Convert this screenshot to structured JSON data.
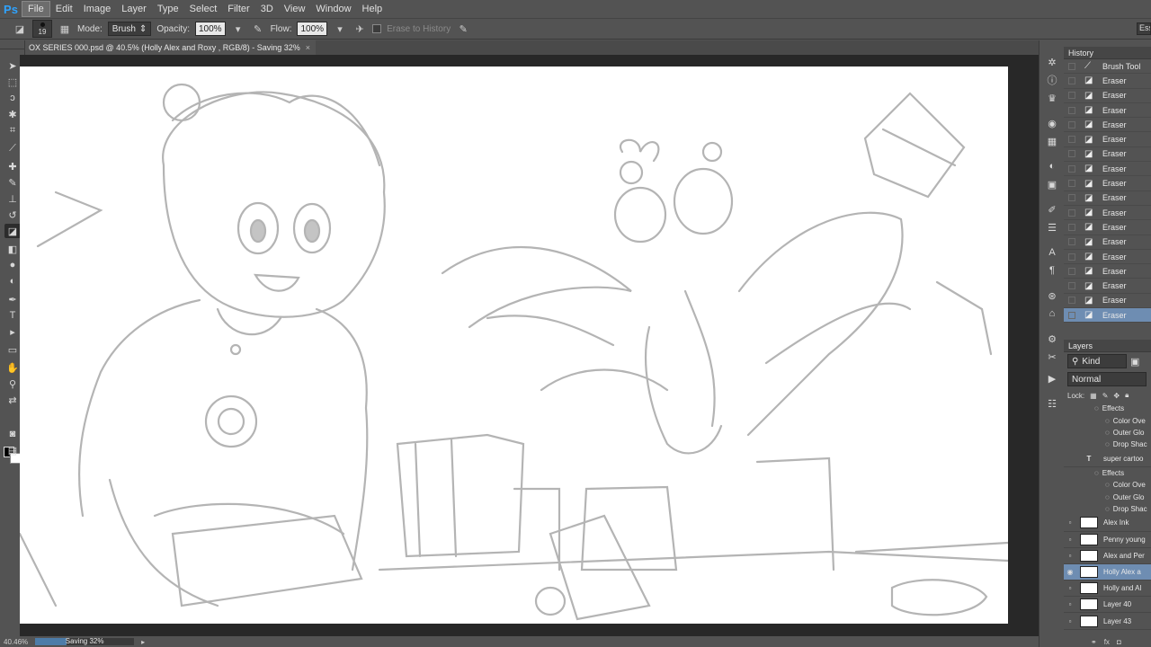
{
  "app": {
    "logo": "Ps"
  },
  "menu": [
    "File",
    "Edit",
    "Image",
    "Layer",
    "Type",
    "Select",
    "Filter",
    "3D",
    "View",
    "Window",
    "Help"
  ],
  "options": {
    "brush_size": "19",
    "mode_label": "Mode:",
    "mode_value": "Brush",
    "opacity_label": "Opacity:",
    "opacity_value": "100%",
    "flow_label": "Flow:",
    "flow_value": "100%",
    "erase_to_history": "Erase to History",
    "workspace": "Ess"
  },
  "document": {
    "tab_title": "OX SERIES 000.psd @ 40.5% (Holly Alex and Roxy , RGB/8) - Saving 32%",
    "close": "×"
  },
  "status": {
    "zoom": "40.46%",
    "progress_label": "Saving 32%",
    "progress": 0.32
  },
  "history": {
    "title": "History",
    "items": [
      {
        "label": "Brush Tool",
        "icon": "brush-icon"
      },
      {
        "label": "Eraser",
        "icon": "eraser-icon"
      },
      {
        "label": "Eraser",
        "icon": "eraser-icon"
      },
      {
        "label": "Eraser",
        "icon": "eraser-icon"
      },
      {
        "label": "Eraser",
        "icon": "eraser-icon"
      },
      {
        "label": "Eraser",
        "icon": "eraser-icon"
      },
      {
        "label": "Eraser",
        "icon": "eraser-icon"
      },
      {
        "label": "Eraser",
        "icon": "eraser-icon"
      },
      {
        "label": "Eraser",
        "icon": "eraser-icon"
      },
      {
        "label": "Eraser",
        "icon": "eraser-icon"
      },
      {
        "label": "Eraser",
        "icon": "eraser-icon"
      },
      {
        "label": "Eraser",
        "icon": "eraser-icon"
      },
      {
        "label": "Eraser",
        "icon": "eraser-icon"
      },
      {
        "label": "Eraser",
        "icon": "eraser-icon"
      },
      {
        "label": "Eraser",
        "icon": "eraser-icon"
      },
      {
        "label": "Eraser",
        "icon": "eraser-icon"
      },
      {
        "label": "Eraser",
        "icon": "eraser-icon"
      },
      {
        "label": "Eraser",
        "icon": "eraser-icon"
      }
    ]
  },
  "layers": {
    "title": "Layers",
    "filter": "Kind",
    "blend_mode": "Normal",
    "lock_label": "Lock:",
    "effects_top": [
      "Effects",
      "Color Ove",
      "Outer Glo",
      "Drop Shac"
    ],
    "text_layer": "super cartoo",
    "effects_bottom": [
      "Effects",
      "Color Ove",
      "Outer Glo",
      "Drop Shac"
    ],
    "rows": [
      {
        "name": "Alex Ink",
        "visible": false
      },
      {
        "name": "Penny young",
        "visible": false
      },
      {
        "name": "Alex and Per",
        "visible": false
      },
      {
        "name": "Holly Alex a",
        "visible": true
      },
      {
        "name": "Holly and Al",
        "visible": false
      },
      {
        "name": "Layer 40",
        "visible": false
      },
      {
        "name": "Layer 43",
        "visible": false
      }
    ],
    "footer": [
      "link-icon",
      "fx-icon",
      "mask-icon"
    ]
  }
}
